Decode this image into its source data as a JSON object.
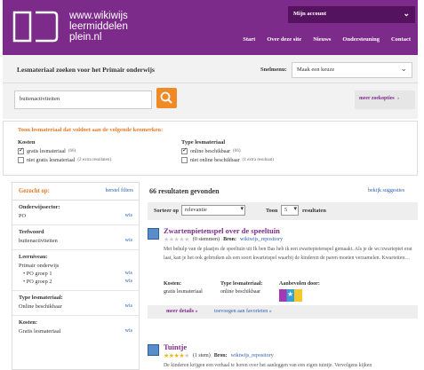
{
  "header": {
    "logo_line1": "www.wikiwijs",
    "logo_line2": "leermiddelen",
    "logo_line3": "plein.nl",
    "account_label": "Mijn account",
    "nav": [
      "Start",
      "Over deze site",
      "Nieuws",
      "Ondersteuning",
      "Contact"
    ]
  },
  "searchbar": {
    "title": "Lesmateriaal zoeken voor het Primair onderwijs",
    "sort_label": "Snelmenu:",
    "sort_value": "Maak een keuze"
  },
  "query": {
    "value": "buitenactiviteiten",
    "more_options": "meer zoekopties"
  },
  "filters": {
    "title": "Toon lesmateriaal dat voldoet aan de volgende kenmerken:",
    "costs_heading": "Kosten",
    "costs_opt1": "gratis lesmateriaal",
    "costs_opt1_count": "(66)",
    "costs_opt2": "niet gratis lesmateriaal",
    "costs_opt2_count": "(2 extra resultaten)",
    "type_heading": "Type lesmateriaal",
    "type_opt1": "online beschikbaar",
    "type_opt1_count": "(66)",
    "type_opt2": "niet online beschikbaar",
    "type_opt2_count": "(1 extra resultaat)"
  },
  "sidebar": {
    "title": "Gezocht op:",
    "clear": "herstel filters",
    "wis": "wis",
    "sector_heading": "Onderwijssector:",
    "sector_value": "PO",
    "keyword_heading": "Trefwoord",
    "keyword_value": "buitenactiviteiten",
    "level_heading": "Leerniveau:",
    "level_value": "Primair onderwijs",
    "level_sub1": "PO groep 1",
    "level_sub2": "PO groep 2",
    "type_heading": "Type lesmateriaal:",
    "type_value": "Online beschikbaar",
    "costs_heading": "Kosten:",
    "costs_value": "Gratis lesmateriaal"
  },
  "results": {
    "count_label": "66 resultaten gevonden",
    "suggestions": "bekijk suggesties",
    "sort_by_label": "Sorteer op",
    "sort_by_value": "relevantie",
    "show_label": "Toon",
    "show_value": "5",
    "show_suffix": "resultaten",
    "items": [
      {
        "title": "Zwartenpietenspel over de speeltuin",
        "votes": "(0 stemmen)",
        "source_label": "Bron:",
        "source": "wikiwijs_repository",
        "description": "Met behulp van de plaatjes de speeltuin uit Ik ben Bas heb ik een zwartepietenspel gemaakt. Als je de wc/zwartepiet erat laat, kan je het ook gebruiken als een soort kwartetspel waarbij de kinderen de paren moeten verzamelen. Kwartetten…",
        "costs_heading": "Kosten:",
        "costs_value": "gratis lesmateriaal",
        "type_heading": "Type lesmateriaal:",
        "type_value": "online beschikbaar",
        "recommended_heading": "Aanbevolen door:",
        "more_details": "meer details »",
        "add_fav": "toevoegen aan favorieten »"
      },
      {
        "title": "Tuintje",
        "votes": "(1 stem)",
        "source_label": "Bron:",
        "source": "wikiwijs_repository",
        "description": "De kinderen krijgen een verhaal te horen over het aanleggen van een eigen tuintje. Vervolgens kijken"
      }
    ]
  }
}
